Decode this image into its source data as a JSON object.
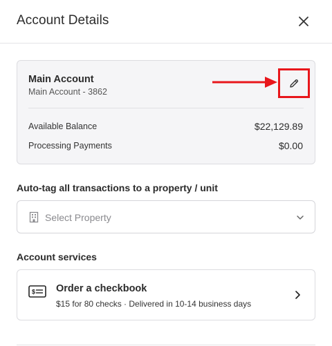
{
  "header": {
    "title": "Account Details",
    "close_icon": "close-icon"
  },
  "account": {
    "name": "Main Account",
    "subtitle": "Main Account - 3862",
    "edit_icon": "pencil-icon",
    "rows": [
      {
        "label": "Available Balance",
        "value": "$22,129.89"
      },
      {
        "label": "Processing Payments",
        "value": "$0.00"
      }
    ]
  },
  "autotag": {
    "label": "Auto-tag all transactions to a property / unit",
    "placeholder": "Select Property",
    "icon": "building-icon"
  },
  "services": {
    "label": "Account services",
    "items": [
      {
        "title": "Order a checkbook",
        "description": "$15 for 80 checks · Delivered in 10-14 business days",
        "icon": "check-icon"
      }
    ]
  },
  "colors": {
    "highlight": "#e8161b",
    "card_bg": "#f5f5f7",
    "text": "#2b2b2b"
  }
}
